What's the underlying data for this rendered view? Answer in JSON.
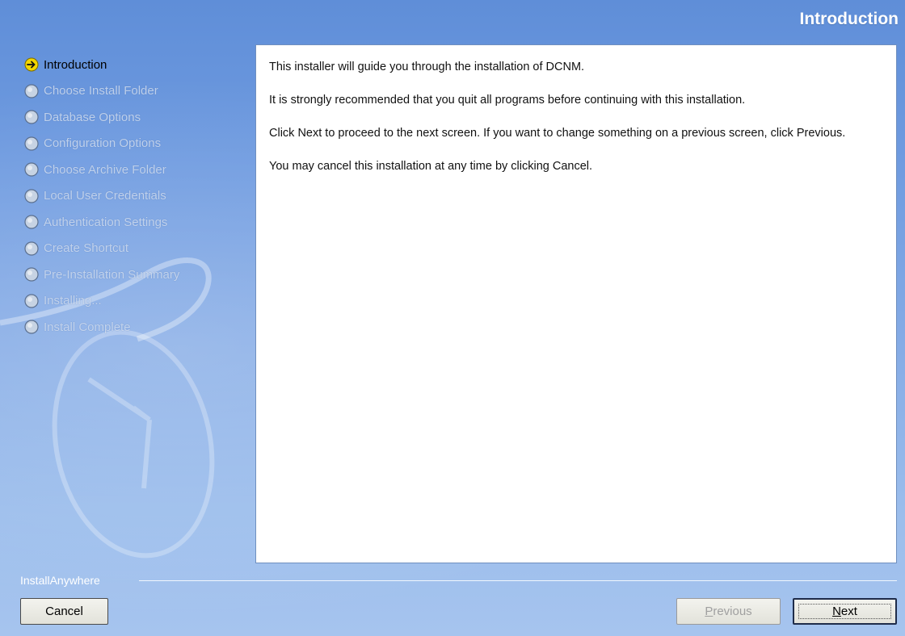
{
  "header": {
    "title": "Introduction"
  },
  "steps": [
    {
      "label": "Introduction",
      "state": "current",
      "icon": "arrow-right-circle-icon"
    },
    {
      "label": "Choose Install Folder",
      "state": "pending",
      "icon": "circle-icon"
    },
    {
      "label": "Database Options",
      "state": "pending",
      "icon": "circle-icon"
    },
    {
      "label": "Configuration Options",
      "state": "pending",
      "icon": "circle-icon"
    },
    {
      "label": "Choose Archive Folder",
      "state": "pending",
      "icon": "circle-icon"
    },
    {
      "label": "Local User Credentials",
      "state": "pending",
      "icon": "circle-icon"
    },
    {
      "label": "Authentication Settings",
      "state": "pending",
      "icon": "circle-icon"
    },
    {
      "label": "Create Shortcut",
      "state": "pending",
      "icon": "circle-icon"
    },
    {
      "label": "Pre-Installation Summary",
      "state": "pending",
      "icon": "circle-icon"
    },
    {
      "label": "Installing...",
      "state": "pending",
      "icon": "circle-icon"
    },
    {
      "label": "Install Complete",
      "state": "pending",
      "icon": "circle-icon"
    }
  ],
  "content": {
    "paragraphs": [
      "This installer will guide you through the installation of DCNM.",
      "It is strongly recommended that you quit all programs before continuing with this installation.",
      "Click Next to proceed to the next screen. If you want to change something on a previous screen, click Previous.",
      "You may cancel this installation at any time by clicking Cancel."
    ]
  },
  "footer": {
    "brand": "InstallAnywhere",
    "cancel_label": "Cancel",
    "previous_first": "P",
    "previous_rest": "revious",
    "next_first": "N",
    "next_rest": "ext"
  },
  "colors": {
    "background_top": "#5f8ed8",
    "background_bottom": "#a6c4ee",
    "current_step_icon": "#f2d600",
    "pending_step_icon": "#c7d3e3"
  },
  "watermark_icon": "computer-mouse-icon"
}
